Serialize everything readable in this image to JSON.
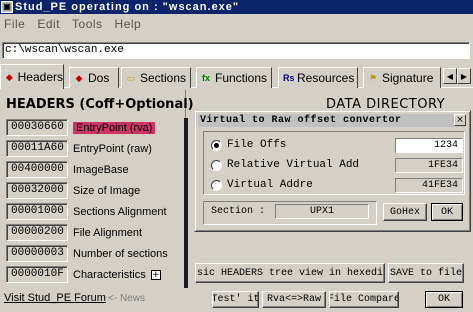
{
  "window": {
    "title": "Stud_PE operating on : \"wscan.exe\"",
    "icon": "app-icon"
  },
  "menu": {
    "items": [
      "File",
      "Edit",
      "Tools",
      "Help"
    ]
  },
  "path": {
    "value": "c:\\wscan\\wscan.exe"
  },
  "tabs": [
    {
      "label": "Headers",
      "icon": "headers-icon",
      "active": true
    },
    {
      "label": "Dos",
      "icon": "dos-icon",
      "active": false
    },
    {
      "label": "Sections",
      "icon": "sections-icon",
      "active": false
    },
    {
      "label": "Functions",
      "icon": "functions-icon",
      "active": false
    },
    {
      "label": "Resources",
      "icon": "resources-icon",
      "active": false
    },
    {
      "label": "Signature",
      "icon": "signature-icon",
      "active": false
    }
  ],
  "headers": {
    "title": "HEADERS (Coff+Optional)",
    "rows": [
      {
        "value": "00030660",
        "label": "EntryPoint (rva)",
        "highlight": true
      },
      {
        "value": "00011A60",
        "label": "EntryPoint (raw)",
        "highlight": false
      },
      {
        "value": "00400000",
        "label": "ImageBase",
        "highlight": false
      },
      {
        "value": "00032000",
        "label": "Size of Image",
        "highlight": false
      },
      {
        "value": "00001000",
        "label": "Sections Alignment",
        "highlight": false
      },
      {
        "value": "00000200",
        "label": "File Alignment",
        "highlight": false
      },
      {
        "value": "00000003",
        "label": "Number of sections",
        "highlight": false
      },
      {
        "value": "0000010F",
        "label": "Characteristics",
        "highlight": false
      }
    ],
    "characteristics_expand": "+"
  },
  "data_directory": {
    "title": "DATA DIRECTORY"
  },
  "converter": {
    "title": "Virtual to Raw offset convertor",
    "close": "×",
    "options": [
      {
        "label": "File Offs",
        "value": "1234",
        "selected": true
      },
      {
        "label": "Relative Virtual Add",
        "value": "1FE34",
        "selected": false
      },
      {
        "label": "Virtual Addre",
        "value": "41FE34",
        "selected": false
      }
    ],
    "section_label": "Section :",
    "section_value": "UPX1",
    "gohex_label": "GoHex",
    "ok_label": "OK"
  },
  "actions": {
    "hexview_label": "sic HEADERS tree view in hexedi",
    "save_label": "SAVE to file",
    "test_label": "Test' it",
    "rva_raw_label": "Rva<=>Raw",
    "file_compare_label": "File Compare",
    "ok_label": "OK"
  },
  "footer": {
    "visit_label": "Visit Stud_PE Forum",
    "news_label": "<- News"
  },
  "colors": {
    "titlebar": "#0a246a",
    "highlight": "#cc3366",
    "face": "#d4d0c8"
  }
}
